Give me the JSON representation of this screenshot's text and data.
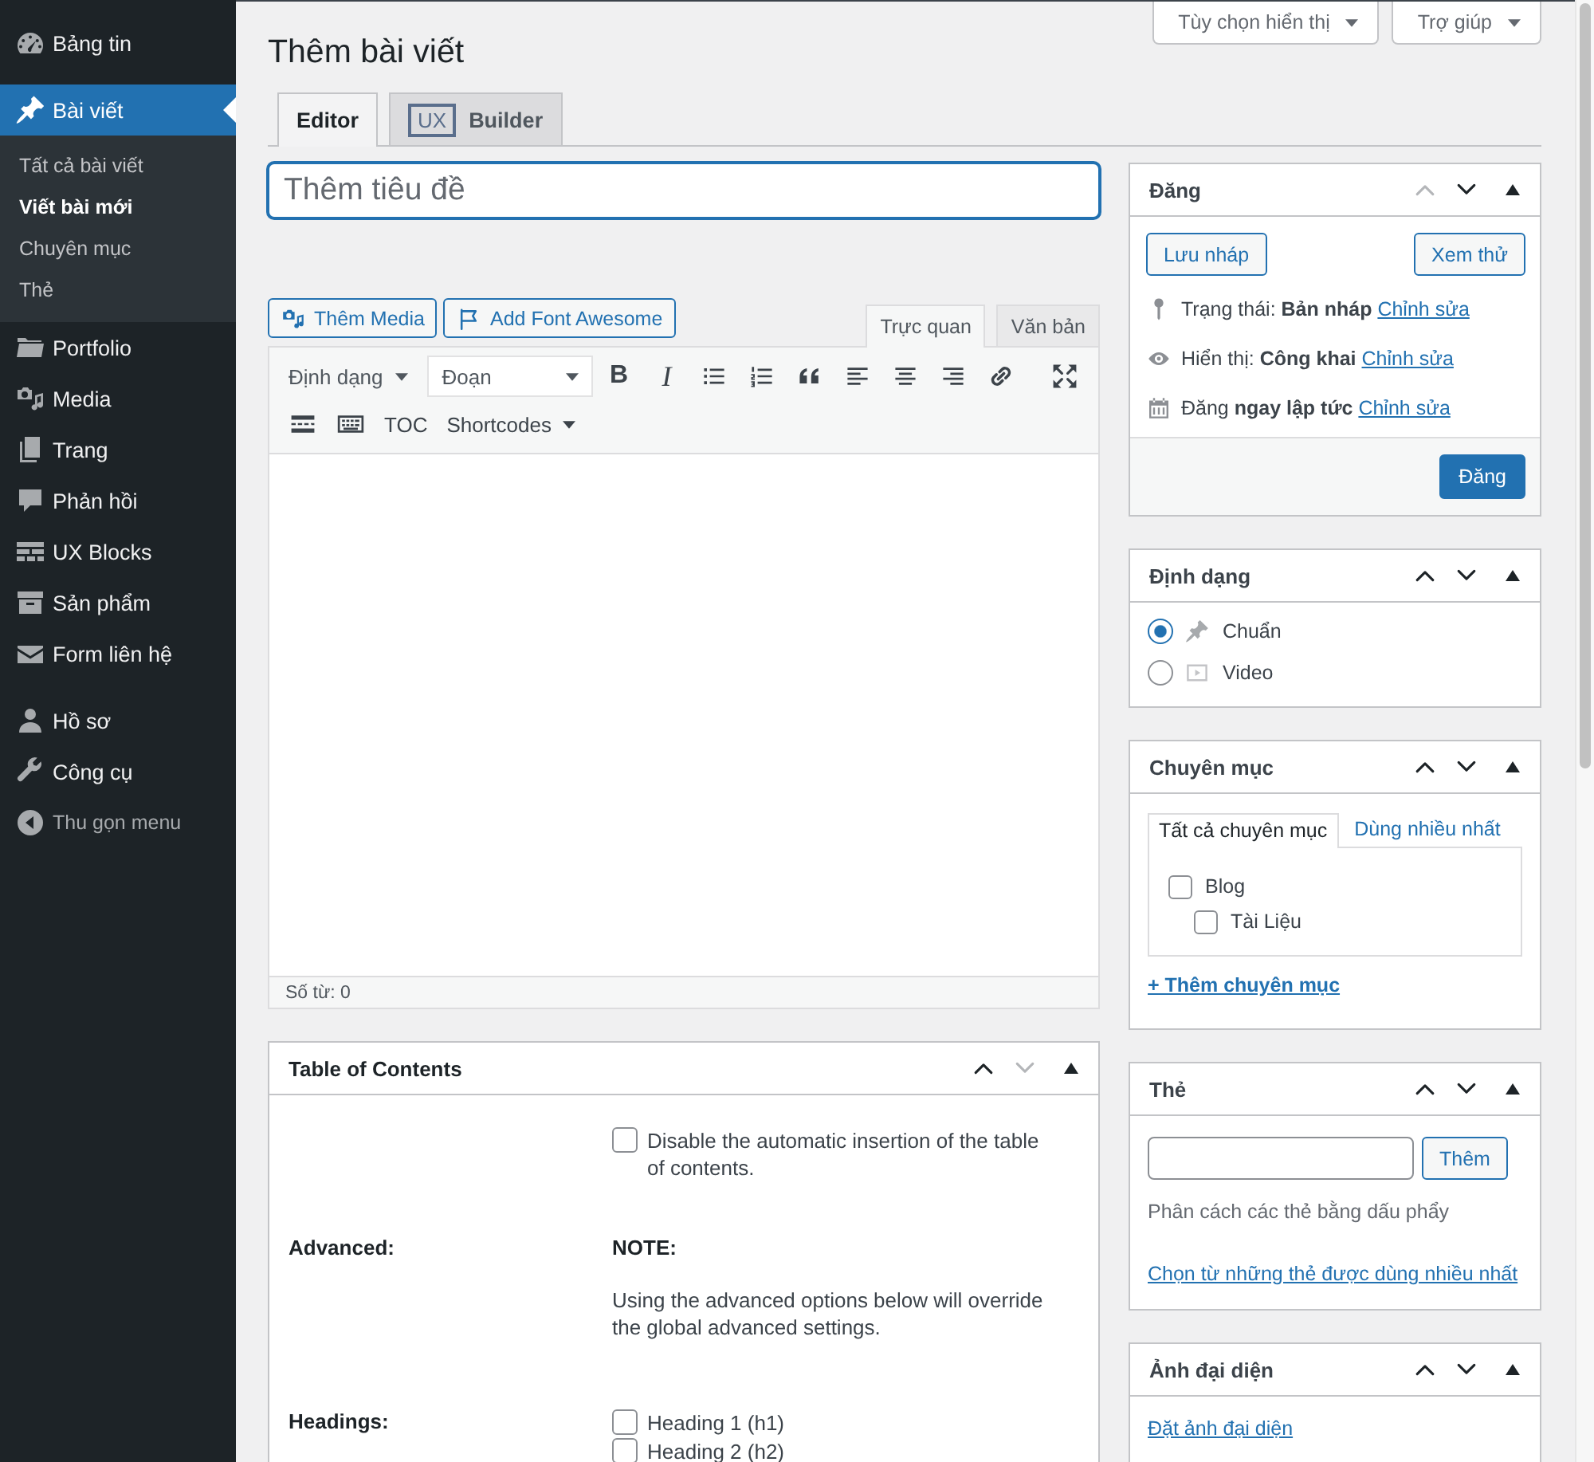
{
  "sidebar": {
    "sections": [
      {
        "items": [
          {
            "label": "Bảng tin",
            "selected": false
          }
        ]
      },
      {
        "items": [
          {
            "label": "Bài viết",
            "selected": true,
            "children": [
              {
                "label": "Tất cả bài viết",
                "selected": false
              },
              {
                "label": "Viết bài mới",
                "selected": true
              },
              {
                "label": "Chuyên mục",
                "selected": false
              },
              {
                "label": "Thẻ",
                "selected": false
              }
            ]
          },
          {
            "label": "Portfolio",
            "selected": false
          },
          {
            "label": "Media",
            "selected": false
          },
          {
            "label": "Trang",
            "selected": false
          },
          {
            "label": "Phản hồi",
            "selected": false
          },
          {
            "label": "UX Blocks",
            "selected": false
          },
          {
            "label": "Sản phẩm",
            "selected": false
          },
          {
            "label": "Form liên hệ",
            "selected": false
          }
        ]
      },
      {
        "items": [
          {
            "label": "Hồ sơ",
            "selected": false
          },
          {
            "label": "Công cụ",
            "selected": false
          }
        ]
      }
    ],
    "collapse_button": "Thu gọn menu"
  },
  "screen_links": [
    {
      "label": "Tùy chọn hiển thị"
    },
    {
      "label": "Trợ giúp"
    }
  ],
  "page_title": "Thêm bài viết",
  "editor_tabs": [
    {
      "label": "Editor",
      "selected": true
    },
    {
      "badge": "UX",
      "label": "Builder",
      "selected": false
    }
  ],
  "title_field": {
    "placeholder": "Thêm tiêu đề",
    "focused": true
  },
  "media_buttons": [
    {
      "label": "Thêm Media"
    },
    {
      "label": "Add Font Awesome"
    }
  ],
  "mode_tabs": [
    {
      "label": "Trực quan",
      "selected": true
    },
    {
      "label": "Văn bản",
      "selected": false
    }
  ],
  "toolbar": {
    "format_menu": "Định dạng",
    "block_format": "Đoạn",
    "bold": "B",
    "italic": "I",
    "toc": "TOC",
    "shortcodes": "Shortcodes"
  },
  "word_count": "Số từ: 0",
  "toc_box": {
    "title": "Table of Contents",
    "up_disabled": false,
    "down_disabled": true,
    "disable_option": {
      "label": "Disable the automatic insertion of the table of contents.",
      "checked": false
    },
    "advanced": {
      "label": "Advanced:",
      "note_title": "NOTE:",
      "note": "Using the advanced options below will override the global advanced settings."
    },
    "headings": {
      "label": "Headings:",
      "options": [
        {
          "label": "Heading 1 (h1)",
          "checked": false
        },
        {
          "label": "Heading 2 (h2)",
          "checked": false
        }
      ]
    }
  },
  "publish_box": {
    "title": "Đăng",
    "up_disabled": true,
    "down_disabled": false,
    "save_draft": "Lưu nháp",
    "preview": "Xem thử",
    "rows": [
      {
        "text": "Trạng thái: **Bản nháp**",
        "link": "Chỉnh sửa"
      },
      {
        "text": "Hiển thị: **Công khai**",
        "link": "Chỉnh sửa"
      },
      {
        "text": "Đăng **ngay lập tức**",
        "link": "Chỉnh sửa"
      }
    ],
    "publish_button": "Đăng"
  },
  "format_box": {
    "title": "Định dạng",
    "up_disabled": false,
    "down_disabled": false,
    "options": [
      {
        "label": "Chuẩn",
        "selected": true
      },
      {
        "label": "Video",
        "selected": false
      }
    ]
  },
  "category_box": {
    "title": "Chuyên mục",
    "up_disabled": false,
    "down_disabled": false,
    "tabs": [
      {
        "label": "Tất cả chuyên mục",
        "selected": true
      },
      {
        "label": "Dùng nhiều nhất",
        "selected": false
      }
    ],
    "categories": [
      {
        "label": "Blog",
        "checked": false,
        "children": [
          {
            "label": "Tài Liệu",
            "checked": false
          }
        ]
      }
    ],
    "add_link": "+ Thêm chuyên mục"
  },
  "tags_box": {
    "title": "Thẻ",
    "up_disabled": false,
    "down_disabled": false,
    "add_button": "Thêm",
    "hint": "Phân cách các thẻ bằng dấu phẩy",
    "choose_link": "Chọn từ những thẻ được dùng nhiều nhất"
  },
  "featured_image_box": {
    "title": "Ảnh đại diện",
    "up_disabled": false,
    "down_disabled": false,
    "set_link": "Đặt ảnh đại diện"
  }
}
